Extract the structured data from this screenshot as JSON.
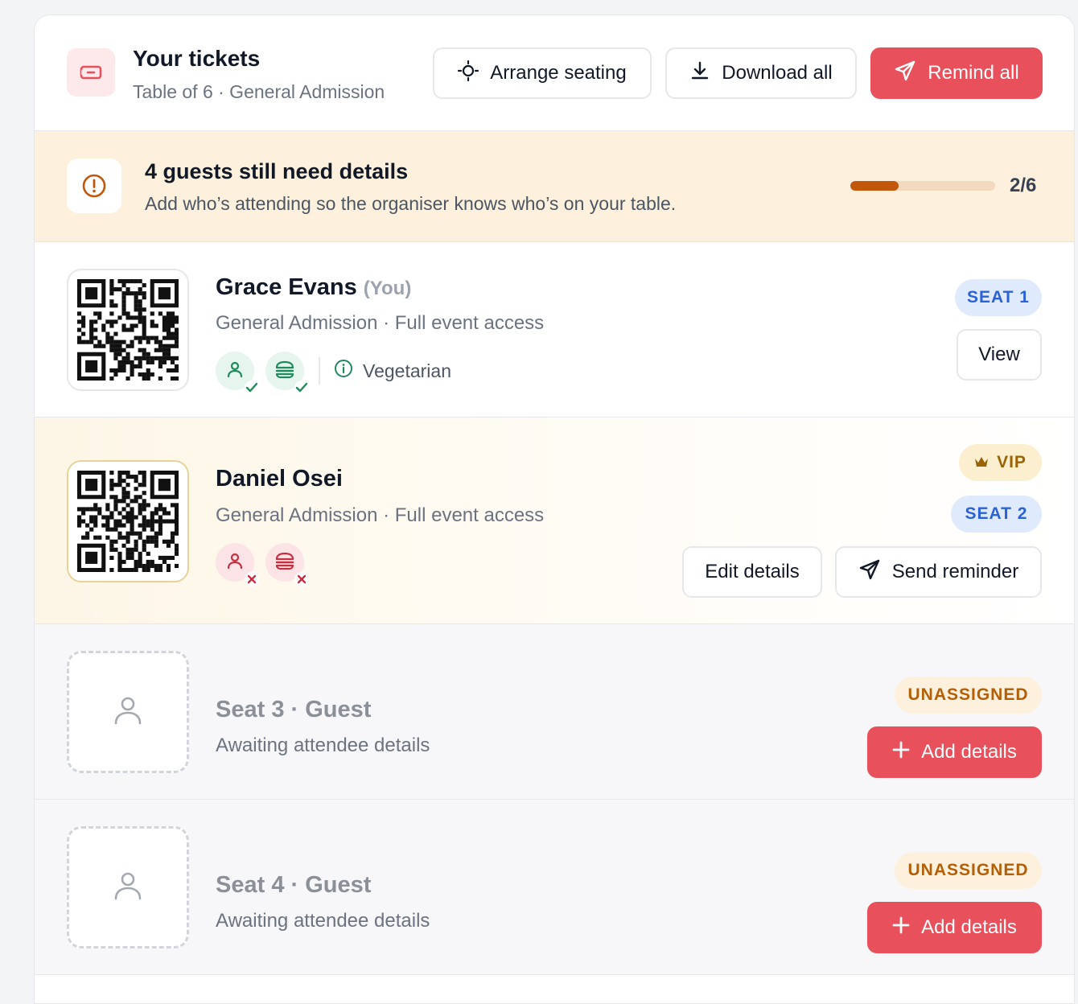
{
  "header": {
    "title": "Your tickets",
    "subtitle": "Table of 6 · General Admission",
    "arrange_label": "Arrange seating",
    "download_label": "Download all",
    "remind_label": "Remind all"
  },
  "banner": {
    "title": "4 guests still need details",
    "subtitle": "Add who’s attending so the organiser knows who’s on your table.",
    "progress_text": "2/6",
    "progress_fraction": 0.333
  },
  "tickets": [
    {
      "name": "Grace Evans",
      "you_tag": "(You)",
      "desc": "General Admission · Full event access",
      "seat": "SEAT 1",
      "diet": "Vegetarian",
      "action": "View",
      "profile_status": "complete",
      "meal_status": "complete"
    },
    {
      "name": "Daniel Osei",
      "desc": "General Admission · Full event access",
      "badge": "VIP",
      "seat": "SEAT 2",
      "edit_label": "Edit details",
      "remind_label": "Send reminder",
      "profile_status": "missing",
      "meal_status": "missing"
    },
    {
      "name": "Seat 3 · Guest",
      "desc": "Awaiting attendee details",
      "status": "UNASSIGNED",
      "action": "Add details"
    },
    {
      "name": "Seat 4 · Guest",
      "desc": "Awaiting attendee details",
      "status": "UNASSIGNED",
      "action": "Add details"
    }
  ],
  "colors": {
    "accent_red": "#e8505b",
    "banner_bg": "#fdf1dd",
    "progress_fill": "#c2570c",
    "seat_blue": "#2b62d6",
    "vip_gold": "#9a6406",
    "ok_green": "#1f8a5b",
    "missing_red": "#c53040"
  },
  "icons": [
    "ticket-icon",
    "target-icon",
    "download-icon",
    "send-icon",
    "alert-circle-icon",
    "user-icon",
    "food-icon",
    "check-icon",
    "x-icon",
    "info-icon",
    "crown-icon",
    "plus-icon",
    "person-placeholder-icon"
  ]
}
